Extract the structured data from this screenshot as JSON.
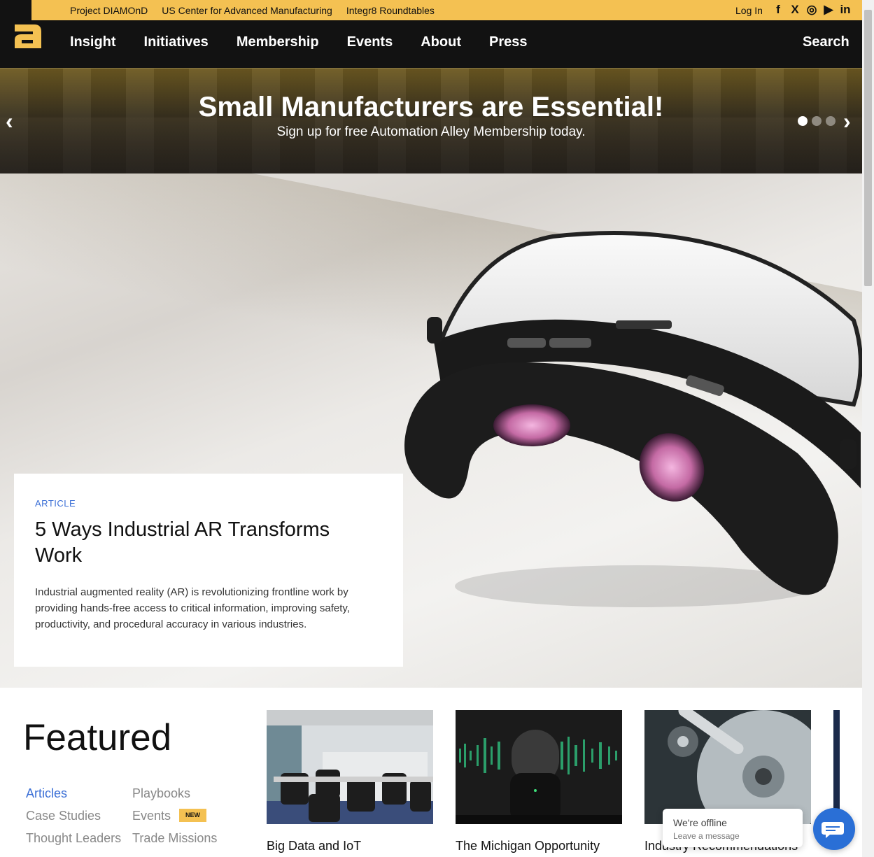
{
  "topbar": {
    "links": [
      "Project DIAMOnD",
      "US Center for Advanced Manufacturing",
      "Integr8 Roundtables"
    ],
    "login": "Log In",
    "socials": [
      {
        "name": "facebook-icon",
        "glyph": "f"
      },
      {
        "name": "x-twitter-icon",
        "glyph": "X"
      },
      {
        "name": "instagram-icon",
        "glyph": "◎"
      },
      {
        "name": "youtube-icon",
        "glyph": "▶"
      },
      {
        "name": "linkedin-icon",
        "glyph": "in"
      }
    ]
  },
  "nav": {
    "items": [
      "Insight",
      "Initiatives",
      "Membership",
      "Events",
      "About",
      "Press"
    ],
    "search": "Search"
  },
  "banner": {
    "title": "Small Manufacturers are Essential!",
    "subtitle": "Sign up for free Automation Alley Membership today.",
    "slide_count": 3,
    "active_slide": 1
  },
  "hero": {
    "tag": "ARTICLE",
    "title": "5 Ways Industrial AR Transforms Work",
    "description": "Industrial augmented reality (AR) is revolutionizing frontline work by providing hands-free access to critical information, improving safety, productivity, and procedural accuracy in various industries."
  },
  "featured": {
    "title": "Featured",
    "categories": [
      "Articles",
      "Playbooks",
      "Case Studies",
      "Events",
      "Thought Leaders",
      "Trade Missions"
    ],
    "active_category": "Articles",
    "new_badge": "NEW",
    "tiles": [
      "Big Data and IoT",
      "The Michigan Opportunity",
      "Industry Recommendations"
    ]
  },
  "chat": {
    "status": "We're offline",
    "prompt": "Leave a message"
  },
  "colors": {
    "accent_yellow": "#f4c152",
    "nav_black": "#121212",
    "link_blue": "#3b6fd6",
    "chat_blue": "#2a6fd6"
  }
}
